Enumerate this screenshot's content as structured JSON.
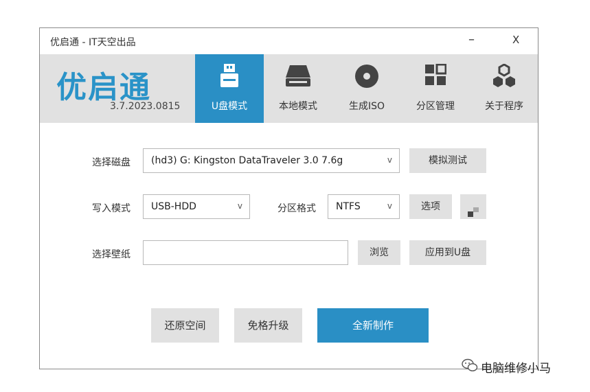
{
  "window": {
    "title": "优启通 - IT天空出品",
    "minimize": "–",
    "close": "X"
  },
  "header": {
    "logo_text": "优启通",
    "version": "3.7.2023.0815",
    "tabs": [
      {
        "label": "U盘模式",
        "icon": "usb-drive-icon",
        "active": true
      },
      {
        "label": "本地模式",
        "icon": "hard-disk-icon",
        "active": false
      },
      {
        "label": "生成ISO",
        "icon": "disc-icon",
        "active": false
      },
      {
        "label": "分区管理",
        "icon": "partition-grid-icon",
        "active": false
      },
      {
        "label": "关于程序",
        "icon": "hexagons-icon",
        "active": false
      }
    ]
  },
  "form": {
    "disk_label": "选择磁盘",
    "disk_value": "(hd3) G: Kingston DataTraveler 3.0 7.6g",
    "simulate_button": "模拟测试",
    "write_mode_label": "写入模式",
    "write_mode_value": "USB-HDD",
    "partition_format_label": "分区格式",
    "partition_format_value": "NTFS",
    "options_button": "选项",
    "wallpaper_label": "选择壁纸",
    "wallpaper_value": "",
    "browse_button": "浏览",
    "apply_button": "应用到U盘",
    "chevron": "v"
  },
  "actions": {
    "restore_space": "还原空间",
    "upgrade": "免格升级",
    "new_create": "全新制作"
  },
  "watermark": {
    "text": "电脑维修小马"
  },
  "colors": {
    "accent": "#2a8fc5",
    "logo": "#2a93c8",
    "header_bg": "#e1e1e1",
    "button_bg": "#e1e1e1"
  }
}
